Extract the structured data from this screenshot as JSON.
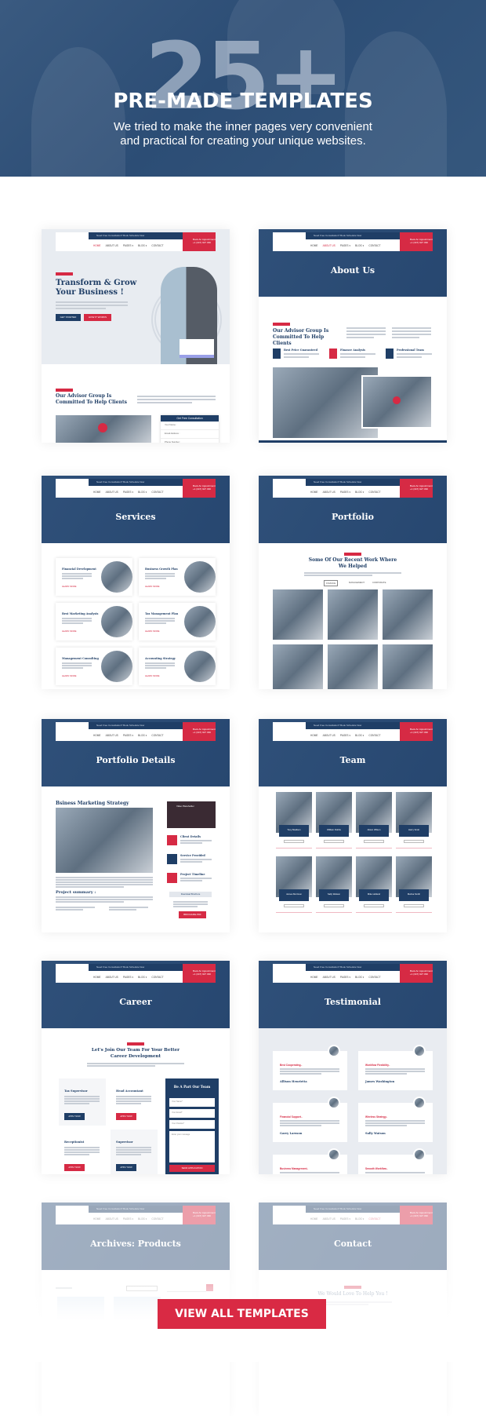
{
  "hero": {
    "big_number": "25+",
    "title": "PRE-MADE TEMPLATES",
    "subtitle": "We tried to make the inner pages very convenient and practical for creating your unique websites."
  },
  "mini_header": {
    "topbar": "Need Free Consultation? Book Schedule Now",
    "nav": [
      "HOME",
      "ABOUT US",
      "PAGES ▾",
      "BLOG ▾",
      "CONTACT"
    ],
    "phone_label": "Book An Appointment",
    "phone": "+1 (347) 927 396"
  },
  "templates": [
    {
      "title": "",
      "active_nav": 0,
      "hero_heading": "Transform & Grow Your Business !",
      "buttons": [
        "GET STARTED",
        "HOW IT WORKS"
      ],
      "section_heading": "Our Advisor Group Is Committed To Help Clients",
      "form_title": "Get Free Consultation",
      "form_fields": [
        "Your Name :",
        "Email Address :",
        "Phone Number :",
        "Enter Your Message"
      ]
    },
    {
      "title": "About Us",
      "active_nav": 1,
      "section_heading": "Our Advisor Group Is Committed To Help Clients",
      "features": [
        "Best Price Guaranteed",
        "Finance Analysis",
        "Professional Team"
      ]
    },
    {
      "title": "Services",
      "active_nav": -1,
      "services": [
        "Financial Development",
        "Business Growth Plan",
        "Best Marketing Analysis",
        "Tax Management Plan",
        "Management Consulting",
        "Accounting Strategy"
      ],
      "link": "LEARN MORE"
    },
    {
      "title": "Portfolio",
      "active_nav": -1,
      "section_heading": "Some Of Our Recent Work Where We Helped",
      "filters": [
        "FINANCE",
        "MANAGEMENT",
        "CORPORATE"
      ]
    },
    {
      "title": "Portfolio Details",
      "active_nav": -1,
      "section_heading": "Bsiness Marketing Strategy",
      "video": "Video Placeholder",
      "info": [
        "Client Details",
        "Service Provided",
        "Project Timeline"
      ],
      "summary": "Project summary :",
      "download": "Download Brochure",
      "pdf": "BROCHURE.PDF"
    },
    {
      "title": "Team",
      "active_nav": -1,
      "members": [
        "Tony Madison",
        "William Dobbs",
        "Alison Wilson",
        "Harry Scott",
        "James Morrison",
        "Sally Watson",
        "Mike Holland",
        "Melina Smith"
      ]
    },
    {
      "title": "Career",
      "active_nav": -1,
      "section_heading": "Let's Join Our Team For Your Better Career Development",
      "jobs": [
        "Tax Supervisor",
        "Head Accountant",
        "Receptionist",
        "Supervisor"
      ],
      "apply": "APPLY NOW",
      "form_title": "Be A Part Our Team",
      "form_fields": [
        "Your Name*",
        "Your Email*",
        "Your Position*",
        "Enter your message"
      ],
      "submit": "SEND APPLICATION"
    },
    {
      "title": "Testimonial",
      "active_nav": -1,
      "quotes": [
        "Best Cooperating..",
        "Workflow Flexibility..",
        "Financial Support..",
        "Wireless Strategy..",
        "Business Management..",
        "Smooth Workflow.."
      ],
      "names": [
        "Allison Henrietta",
        "James Washington",
        "Garry Larsson",
        "Sally Watson"
      ]
    },
    {
      "title": "Archives: Products",
      "active_nav": -1
    },
    {
      "title": "Contact",
      "active_nav": 4,
      "section_heading": "We Would Love To Help You !"
    }
  ],
  "cta": "VIEW ALL TEMPLATES",
  "colors": {
    "brand_blue": "#1f3e66",
    "accent_red": "#d62a44"
  }
}
